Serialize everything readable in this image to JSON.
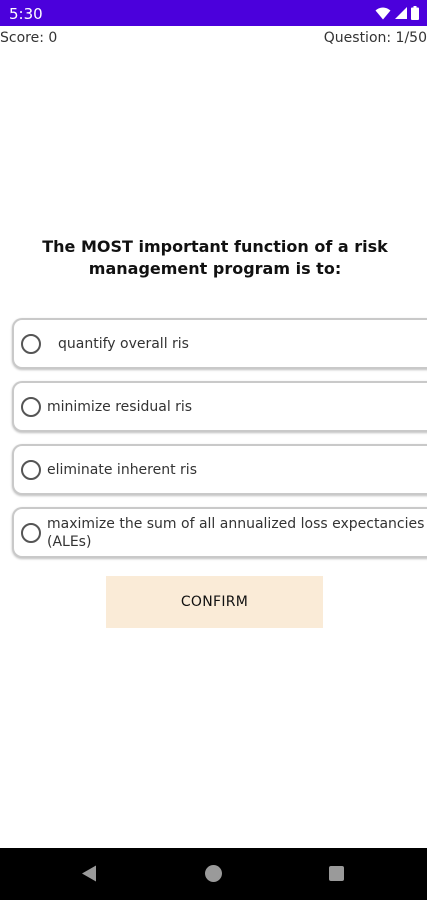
{
  "status_bar": {
    "time": "5:30",
    "icons": [
      "wifi-icon",
      "signal-icon",
      "battery-icon"
    ],
    "background": "#4b00dc"
  },
  "header": {
    "score": "Score: 0",
    "question_number": "Question: 1/50"
  },
  "question": {
    "text": "The MOST important function of a risk management program is to:"
  },
  "options": [
    {
      "label": "quantify overall ris",
      "selected": false
    },
    {
      "label": "minimize residual ris",
      "selected": false
    },
    {
      "label": "eliminate inherent ris",
      "selected": false
    },
    {
      "label": "maximize the sum of all annualized loss expectancies (ALEs)",
      "selected": false
    }
  ],
  "confirm": {
    "label": "CONFIRM",
    "background": "#faebd7"
  },
  "nav_bar": {
    "icons": [
      "back-icon",
      "home-icon",
      "recents-icon"
    ]
  }
}
